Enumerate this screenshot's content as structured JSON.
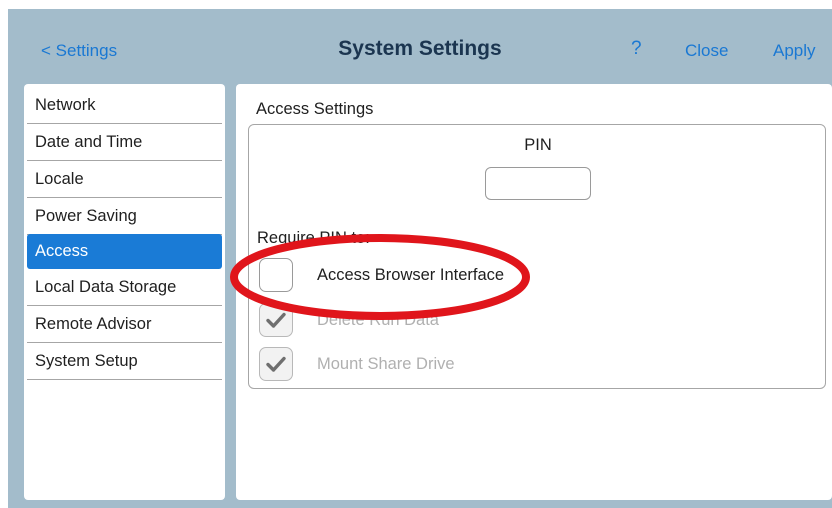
{
  "header": {
    "back_label": "< Settings",
    "title": "System Settings",
    "help_label": "?",
    "close_label": "Close",
    "apply_label": "Apply"
  },
  "sidebar": {
    "items": [
      {
        "label": "Network"
      },
      {
        "label": "Date and Time"
      },
      {
        "label": "Locale"
      },
      {
        "label": "Power Saving"
      },
      {
        "label": "Access",
        "active": true
      },
      {
        "label": "Local Data Storage"
      },
      {
        "label": "Remote Advisor"
      },
      {
        "label": "System Setup"
      }
    ]
  },
  "main": {
    "section_title": "Access Settings",
    "pin": {
      "label": "PIN",
      "value": ""
    },
    "require_label": "Require PIN to:",
    "options": [
      {
        "label": "Access Browser Interface",
        "checked": false,
        "disabled": false
      },
      {
        "label": "Delete Run Data",
        "checked": true,
        "disabled": true
      },
      {
        "label": "Mount Share Drive",
        "checked": true,
        "disabled": true
      }
    ]
  },
  "colors": {
    "header_bg": "#a3bccb",
    "accent": "#1a7bd6",
    "annotation": "#e0151b"
  },
  "icons": {
    "check": "check-icon"
  }
}
